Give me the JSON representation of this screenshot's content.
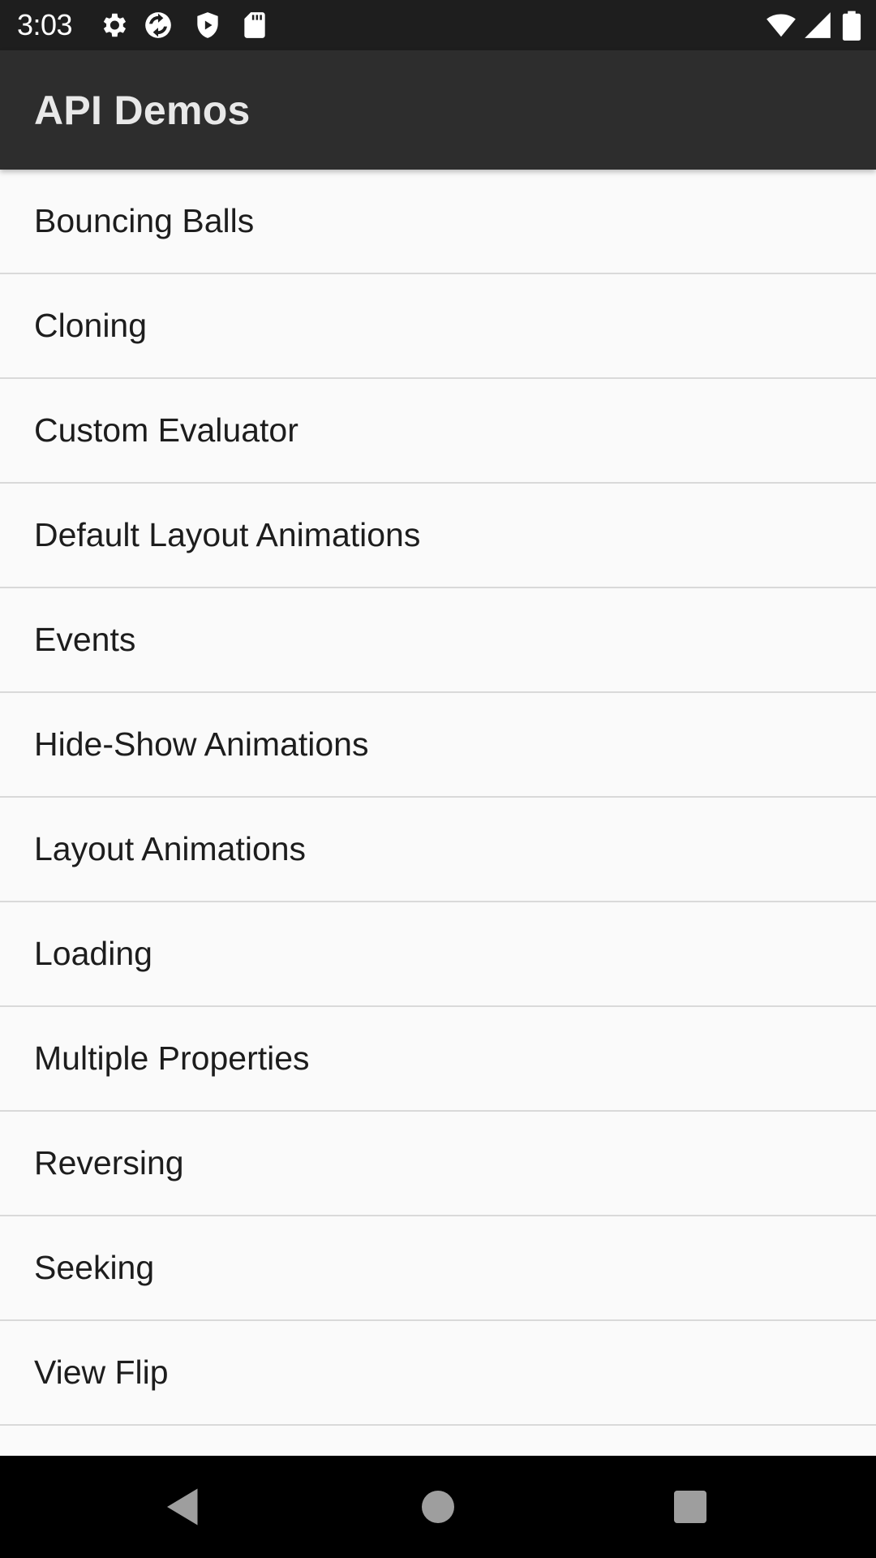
{
  "status_bar": {
    "time": "3:03",
    "icons_left": [
      "settings-gear-icon",
      "sync-icon",
      "shield-icon",
      "sd-card-icon"
    ],
    "icons_right": [
      "wifi-icon",
      "cell-signal-icon",
      "battery-icon"
    ]
  },
  "app_bar": {
    "title": "API Demos"
  },
  "list": {
    "items": [
      {
        "label": "Bouncing Balls"
      },
      {
        "label": "Cloning"
      },
      {
        "label": "Custom Evaluator"
      },
      {
        "label": "Default Layout Animations"
      },
      {
        "label": "Events"
      },
      {
        "label": "Hide-Show Animations"
      },
      {
        "label": "Layout Animations"
      },
      {
        "label": "Loading"
      },
      {
        "label": "Multiple Properties"
      },
      {
        "label": "Reversing"
      },
      {
        "label": "Seeking"
      },
      {
        "label": "View Flip"
      },
      {
        "label": ""
      }
    ]
  },
  "nav_bar": {
    "buttons": [
      "back-icon",
      "home-icon",
      "recents-icon"
    ]
  },
  "colors": {
    "status_bar_bg": "#1e1e1e",
    "app_bar_bg": "#2d2d2d",
    "list_bg": "#fafafa",
    "divider": "#d9d9d9",
    "nav_bar_bg": "#000000",
    "nav_icon": "#9e9e9e"
  }
}
